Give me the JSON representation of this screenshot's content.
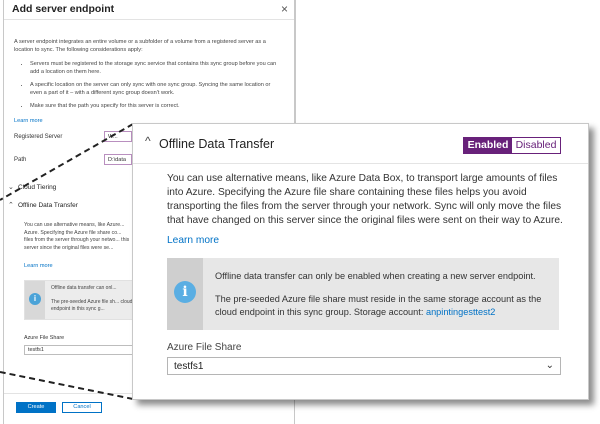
{
  "blade": {
    "title": "Add server endpoint",
    "intro": "A server endpoint integrates an entire volume or a subfolder of a volume from a registered server as a location to sync. The following considerations apply:",
    "bullets": [
      "Servers must be registered to the storage sync service that contains this sync group before you can add a location on them here.",
      "A specific location on the server can only sync with one sync group. Syncing the same location or even a part of it – with a different sync group doesn't work.",
      "Make sure that the path you specify for this server is correct."
    ],
    "learn_more": "Learn more",
    "registered_server_label": "Registered Server",
    "registered_server_value": "W...",
    "path_label": "Path",
    "path_value": "D:\\data",
    "cloud_tiering_label": "Cloud Tiering",
    "offline_label": "Offline Data Transfer",
    "offline_text": "You can use alternative means, like Azure... Azure. Specifying the Azure file share co... files from the server through your netwo... this server since the original files were se...",
    "offline_learn_more": "Learn more",
    "info_text1": "Offline data transfer can onl...",
    "info_text2": "The pre-seeded Azure file sh... cloud endpoint in this sync g...",
    "file_share_label": "Azure File Share",
    "file_share_value": "testfs1",
    "create_label": "Create",
    "cancel_label": "Cancel"
  },
  "zoom": {
    "title": "Offline Data Transfer",
    "toggle_on": "Enabled",
    "toggle_off": "Disabled",
    "description": "You can use alternative means, like Azure Data Box, to transport large amounts of files into Azure. Specifying the Azure file share containing these files helps you avoid transporting the files from the server through your network. Sync will only move the files that have changed on this server since the original files were sent on their way to Azure.",
    "learn_more": "Learn more",
    "info_text1": "Offline data transfer can only be enabled when creating a new server endpoint.",
    "info_text2": "The pre-seeded Azure file share must reside in the same storage account as the cloud endpoint in this sync group. Storage account:",
    "storage_account": "anpintingesttest2",
    "file_share_label": "Azure File Share",
    "file_share_value": "testfs1"
  },
  "icons": {
    "chevron_up": "chevron-up-icon",
    "chevron_down": "chevron-down-icon",
    "info": "info-icon",
    "close": "close-icon"
  },
  "colors": {
    "accent_purple": "#68217a",
    "link_blue": "#0072c6",
    "info_blue": "#5aaee3"
  }
}
